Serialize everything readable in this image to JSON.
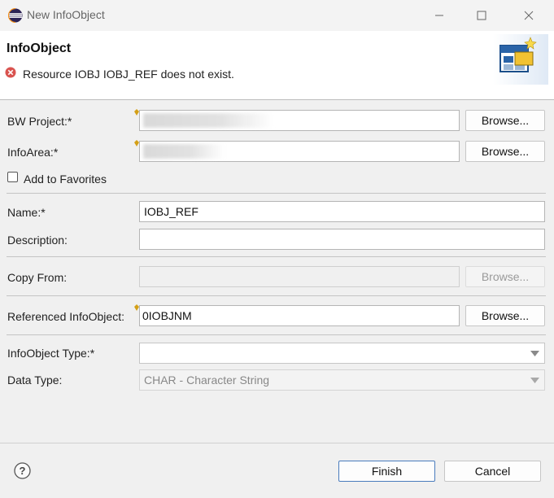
{
  "window": {
    "title": "New InfoObject",
    "controls": [
      "minimize",
      "maximize",
      "close"
    ]
  },
  "header": {
    "title": "InfoObject",
    "error_message": "Resource IOBJ IOBJ_REF does not exist."
  },
  "form": {
    "bw_project": {
      "label": "BW Project:*",
      "value": "",
      "browse_label": "Browse..."
    },
    "info_area": {
      "label": "InfoArea:*",
      "value": "",
      "browse_label": "Browse..."
    },
    "add_to_favorites": {
      "label": "Add to Favorites",
      "checked": false
    },
    "name": {
      "label": "Name:*",
      "value": "IOBJ_REF"
    },
    "description": {
      "label": "Description:",
      "value": ""
    },
    "copy_from": {
      "label": "Copy From:",
      "value": "",
      "browse_label": "Browse..."
    },
    "referenced_infoobject": {
      "label": "Referenced InfoObject:",
      "value": "0IOBJNM",
      "browse_label": "Browse..."
    },
    "infoobject_type": {
      "label": "InfoObject Type:*",
      "value": ""
    },
    "data_type": {
      "label": "Data Type:",
      "value": "CHAR - Character String"
    }
  },
  "footer": {
    "finish_label": "Finish",
    "cancel_label": "Cancel"
  },
  "colors": {
    "accent": "#4a7cbd",
    "error": "#d9534f",
    "marker": "#d4a017"
  }
}
